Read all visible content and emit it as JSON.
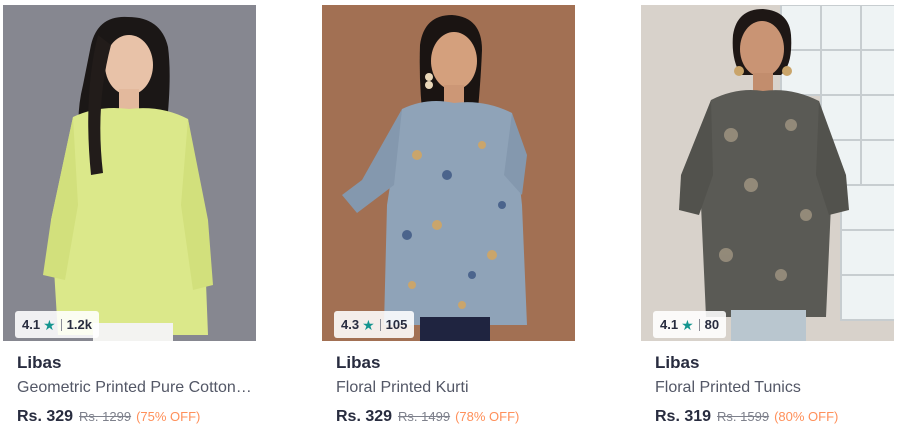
{
  "products": [
    {
      "brand": "Libas",
      "title": "Geometric Printed Pure Cotton Top",
      "rating": "4.1",
      "rating_count": "1.2k",
      "price": "Rs. 329",
      "mrp": "Rs. 1299",
      "discount": "(75% OFF)",
      "image": "woman-in-yellow-printed-top"
    },
    {
      "brand": "Libas",
      "title": "Floral Printed Kurti",
      "rating": "4.3",
      "rating_count": "105",
      "price": "Rs. 329",
      "mrp": "Rs. 1499",
      "discount": "(78% OFF)",
      "image": "woman-in-blue-floral-kurti"
    },
    {
      "brand": "Libas",
      "title": "Floral Printed Tunics",
      "rating": "4.1",
      "rating_count": "80",
      "price": "Rs. 319",
      "mrp": "Rs. 1599",
      "discount": "(80% OFF)",
      "image": "woman-in-grey-floral-tunic"
    }
  ],
  "colors": {
    "rating_star": "#14958f",
    "discount": "#ff905a",
    "text_primary": "#282c3f"
  }
}
